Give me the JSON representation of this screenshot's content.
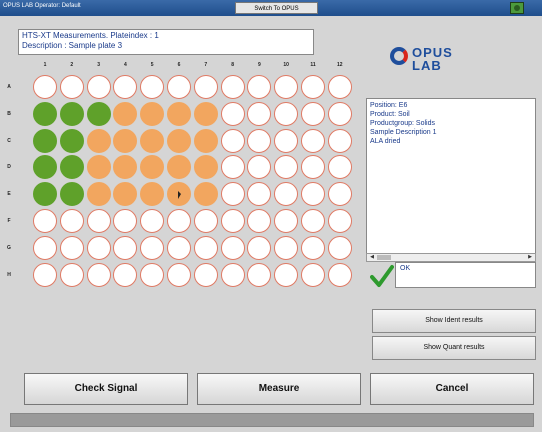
{
  "window": {
    "title": "OPUS LAB Operator: Default",
    "switch_label": "Switch To OPUS"
  },
  "info": {
    "line1": "HTS-XT Measurements. Plateindex : 1",
    "line2": "Description : Sample plate 3"
  },
  "logo": {
    "opus": "OPUS",
    "lab": "LAB"
  },
  "plate": {
    "columns": [
      "1",
      "2",
      "3",
      "4",
      "5",
      "6",
      "7",
      "8",
      "9",
      "10",
      "11",
      "12"
    ],
    "rows": [
      "A",
      "B",
      "C",
      "D",
      "E",
      "F",
      "G",
      "H"
    ],
    "well_states": [
      "wwwwwwwwwwww",
      "gggoooowwwww",
      "ggooooowwwww",
      "ggooooowwwww",
      "ggooooowwwww",
      "wwwwwwwwwwww",
      "wwwwwwwwwwww",
      "wwwwwwwwwwww"
    ],
    "state_legend": {
      "g": "green",
      "o": "orange",
      "w": "empty"
    },
    "colors": {
      "green": "#5fa12a",
      "orange": "#f2a65f",
      "empty_border": "#e07a64"
    }
  },
  "position_info": {
    "lines": [
      "Position: E6",
      "Product: Soil",
      "Productgroup: Solids",
      "Sample Description 1",
      "ALA dried"
    ]
  },
  "status": {
    "text": "OK",
    "icon": "checkmark-icon"
  },
  "side_buttons": {
    "ident": "Show Ident results",
    "quant": "Show Quant results"
  },
  "bottom_buttons": {
    "check_signal": "Check Signal",
    "measure": "Measure",
    "cancel": "Cancel"
  }
}
